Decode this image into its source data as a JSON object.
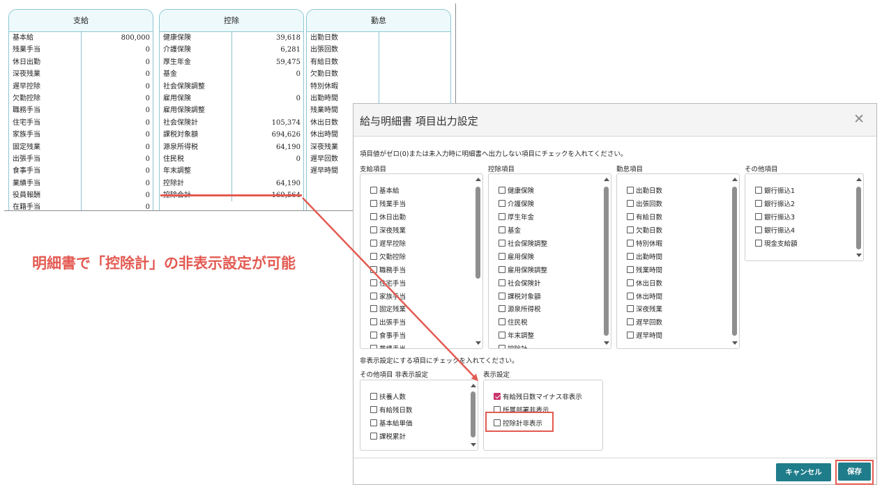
{
  "payslip": {
    "pay": {
      "title": "支給",
      "rows": [
        {
          "label": "基本給",
          "value": "800,000"
        },
        {
          "label": "残業手当",
          "value": "0"
        },
        {
          "label": "休日出勤",
          "value": "0"
        },
        {
          "label": "深夜残業",
          "value": "0"
        },
        {
          "label": "遅早控除",
          "value": "0"
        },
        {
          "label": "欠勤控除",
          "value": "0"
        },
        {
          "label": "職務手当",
          "value": "0"
        },
        {
          "label": "住宅手当",
          "value": "0"
        },
        {
          "label": "家族手当",
          "value": "0"
        },
        {
          "label": "固定残業",
          "value": "0"
        },
        {
          "label": "出張手当",
          "value": "0"
        },
        {
          "label": "食事手当",
          "value": "0"
        },
        {
          "label": "業績手当",
          "value": "0"
        },
        {
          "label": "役員報酬",
          "value": "0"
        },
        {
          "label": "在籍手当",
          "value": "0"
        }
      ]
    },
    "deduction": {
      "title": "控除",
      "rows": [
        {
          "label": "健康保険",
          "value": "39,618"
        },
        {
          "label": "介護保険",
          "value": "6,281"
        },
        {
          "label": "厚生年金",
          "value": "59,475"
        },
        {
          "label": "基金",
          "value": "0"
        },
        {
          "label": "社会保険調整",
          "value": ""
        },
        {
          "label": "雇用保険",
          "value": "0"
        },
        {
          "label": "雇用保険調整",
          "value": ""
        },
        {
          "label": "社会保険計",
          "value": "105,374"
        },
        {
          "label": "課税対象額",
          "value": "694,626"
        },
        {
          "label": "源泉所得税",
          "value": "64,190"
        },
        {
          "label": "住民税",
          "value": "0"
        },
        {
          "label": "年末調整",
          "value": ""
        },
        {
          "label": "控除計",
          "value": "64,190"
        },
        {
          "label": "控除合計",
          "value": "169,564"
        }
      ]
    },
    "attendance": {
      "title": "勤怠",
      "rows": [
        {
          "label": "出勤日数"
        },
        {
          "label": "出張回数"
        },
        {
          "label": "有給日数"
        },
        {
          "label": "欠勤日数"
        },
        {
          "label": "特別休暇"
        },
        {
          "label": "出勤時間"
        },
        {
          "label": "残業時間"
        },
        {
          "label": "休出日数"
        },
        {
          "label": "休出時間"
        },
        {
          "label": "深夜残業"
        },
        {
          "label": "遅早回数"
        },
        {
          "label": "遅早時間"
        }
      ]
    }
  },
  "annotation": "明細書で「控除計」の非表示設定が可能",
  "modal": {
    "title": "給与明細書 項目出力設定",
    "close_icon": "close-icon",
    "instruction": "項目値がゼロ(0)または未入力時に明細書へ出力しない項目にチェックを入れてください。",
    "pay_items": {
      "label": "支給項目",
      "items": [
        "基本給",
        "残業手当",
        "休日出勤",
        "深夜残業",
        "遅早控除",
        "欠勤控除",
        "職務手当",
        "住宅手当",
        "家族手当",
        "固定残業",
        "出張手当",
        "食事手当",
        "業績手当"
      ]
    },
    "deduction_items": {
      "label": "控除項目",
      "items": [
        "健康保険",
        "介護保険",
        "厚生年金",
        "基金",
        "社会保険調整",
        "雇用保険",
        "雇用保険調整",
        "社会保険計",
        "課税対象額",
        "源泉所得税",
        "住民税",
        "年末調整",
        "控除計"
      ]
    },
    "attendance_items": {
      "label": "勤怠項目",
      "items": [
        "出勤日数",
        "出張回数",
        "有給日数",
        "欠勤日数",
        "特別休暇",
        "出勤時間",
        "残業時間",
        "休出日数",
        "休出時間",
        "深夜残業",
        "遅早回数",
        "遅早時間"
      ]
    },
    "other_items": {
      "label": "その他項目",
      "items": [
        "銀行振込1",
        "銀行振込2",
        "銀行振込3",
        "銀行振込4",
        "現金支給額"
      ]
    },
    "hide_instruction": "非表示設定にする項目にチェックを入れてください。",
    "other_hide": {
      "label": "その他項目 非表示設定",
      "items": [
        "扶養人数",
        "有給残日数",
        "基本給単価",
        "課税累計"
      ]
    },
    "display_settings": {
      "label": "表示設定",
      "items": [
        {
          "label": "有給残日数マイナス非表示",
          "checked": true
        },
        {
          "label": "所属部署非表示",
          "checked": false
        },
        {
          "label": "控除計非表示",
          "checked": false
        }
      ]
    },
    "cancel_label": "キャンセル",
    "save_label": "保存"
  },
  "colors": {
    "accent": "#1f7c8a",
    "highlight": "#e35a52",
    "checkbox_checked": "#c8366c",
    "panel_border": "#8dc6d2"
  }
}
